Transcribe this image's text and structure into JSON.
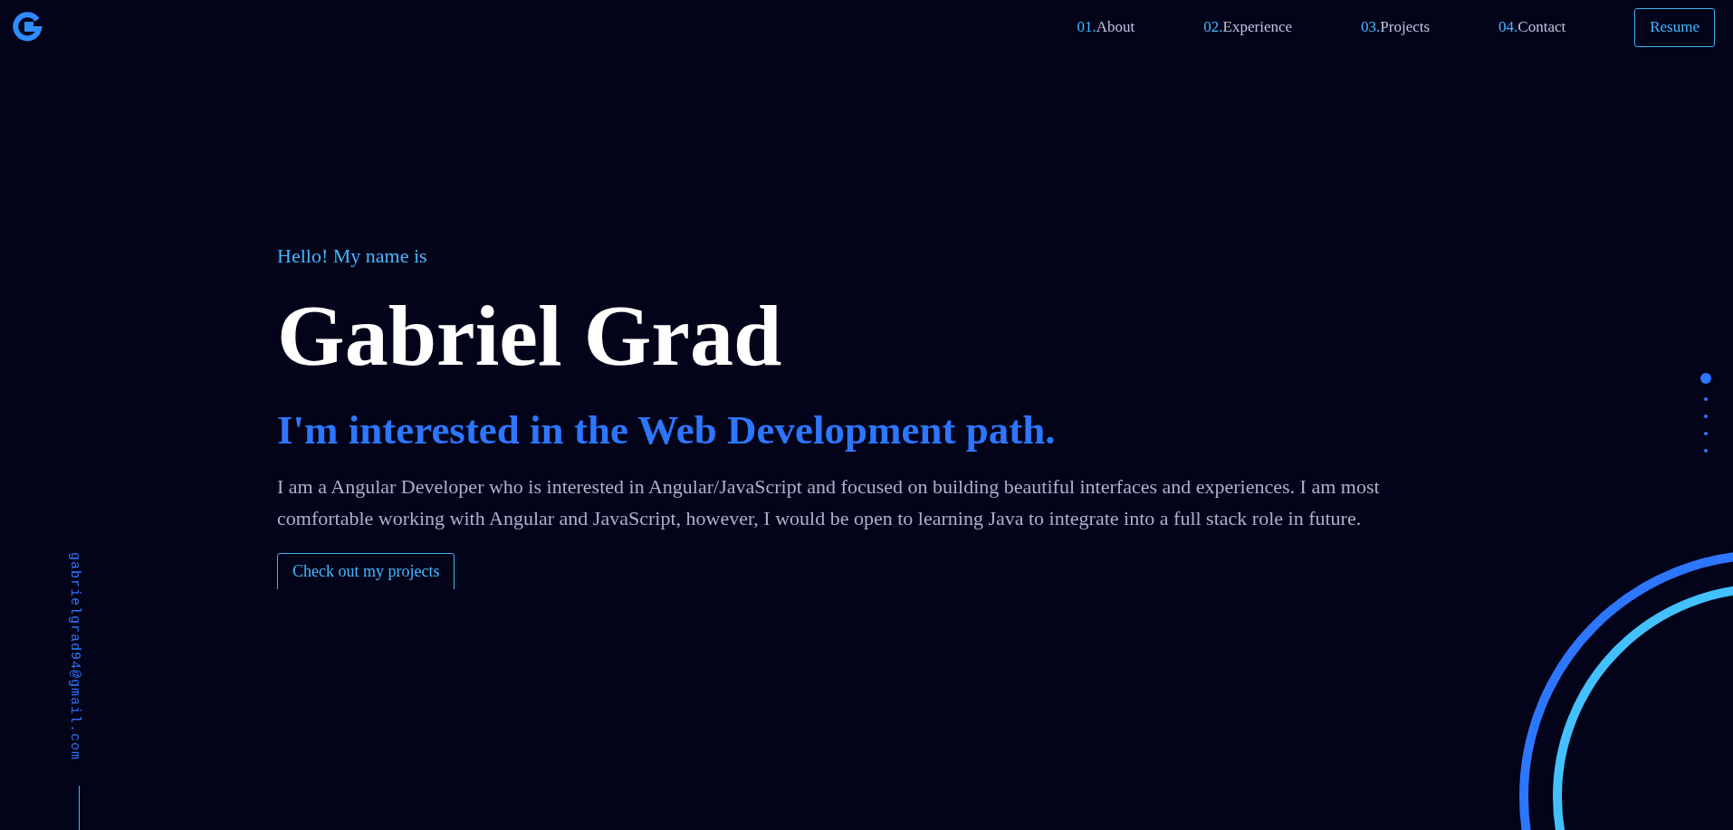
{
  "logo": {
    "kind": "letter-mark"
  },
  "nav": {
    "links": [
      {
        "number": "01.",
        "label": "About"
      },
      {
        "number": "02.",
        "label": "Experience"
      },
      {
        "number": "03.",
        "label": "Projects"
      },
      {
        "number": "04.",
        "label": "Contact"
      }
    ],
    "resume_button": "Resume"
  },
  "hero": {
    "greeting": "Hello! My name is",
    "name": "Gabriel Grad",
    "tagline": "I'm interested in the Web Development path.",
    "bio": "I am a Angular Developer who is interested in Angular/JavaScript and focused on building beautiful interfaces and experiences. I am most comfortable working with Angular and JavaScript, however, I would be open to learning Java to integrate into a full stack role in future.",
    "cta_button": "Check out my projects"
  },
  "side_email": "gabrielgrad94@gmail.com",
  "section_dots": [
    {
      "selected": true
    },
    {
      "selected": false
    },
    {
      "selected": false
    },
    {
      "selected": false
    },
    {
      "selected": false
    }
  ]
}
